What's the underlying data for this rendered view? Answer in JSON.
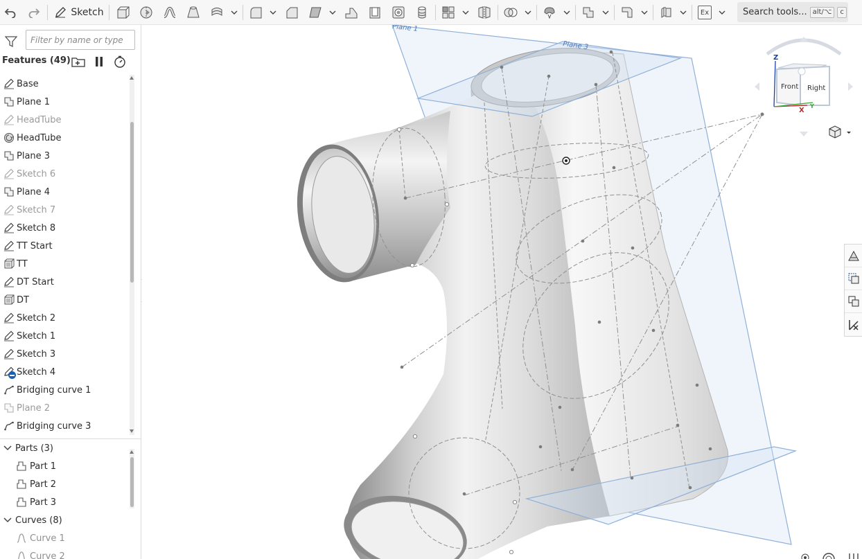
{
  "toolbar": {
    "sketch_label": "Sketch",
    "ex_label": "Ex",
    "search_label": "Search tools...",
    "search_shortcut_mod": "alt/⌥",
    "search_shortcut_key": "c"
  },
  "sidebar": {
    "filter_placeholder": "Filter by name or type",
    "features_header": "Features (49)",
    "features": [
      {
        "label": "Base",
        "icon": "sketch-icon",
        "dim": false
      },
      {
        "label": "Plane 1",
        "icon": "plane-icon",
        "dim": false
      },
      {
        "label": "HeadTube",
        "icon": "sketch-icon",
        "dim": true
      },
      {
        "label": "HeadTube",
        "icon": "revolve-icon",
        "dim": false
      },
      {
        "label": "Plane 3",
        "icon": "plane-icon",
        "dim": false
      },
      {
        "label": "Sketch 6",
        "icon": "sketch-icon",
        "dim": true
      },
      {
        "label": "Plane 4",
        "icon": "plane-icon",
        "dim": false
      },
      {
        "label": "Sketch 7",
        "icon": "sketch-icon",
        "dim": true
      },
      {
        "label": "Sketch 8",
        "icon": "sketch-icon",
        "dim": false
      },
      {
        "label": "TT Start",
        "icon": "sketch-icon",
        "dim": false
      },
      {
        "label": "TT",
        "icon": "extrude-icon",
        "dim": false
      },
      {
        "label": "DT Start",
        "icon": "sketch-icon",
        "dim": false
      },
      {
        "label": "DT",
        "icon": "extrude-icon",
        "dim": false
      },
      {
        "label": "Sketch 2",
        "icon": "sketch-icon",
        "dim": false
      },
      {
        "label": "Sketch 1",
        "icon": "sketch-icon",
        "dim": false
      },
      {
        "label": "Sketch 3",
        "icon": "sketch-icon",
        "dim": false
      },
      {
        "label": "Sketch 4",
        "icon": "sketch-error-icon",
        "dim": false
      },
      {
        "label": "Bridging curve 1",
        "icon": "curve-icon",
        "dim": false
      },
      {
        "label": "Plane 2",
        "icon": "plane-icon",
        "dim": true
      },
      {
        "label": "Bridging curve 3",
        "icon": "curve-icon",
        "dim": false
      }
    ],
    "groups": {
      "parts_label": "Parts (3)",
      "parts": [
        "Part 1",
        "Part 2",
        "Part 3"
      ],
      "curves_label": "Curves (8)",
      "curves": [
        "Curve 1",
        "Curve 2"
      ]
    }
  },
  "viewport": {
    "plane_labels": [
      "Plane 1",
      "Plane 3"
    ],
    "view_cube": {
      "front_label": "Front",
      "right_label": "Right",
      "axis_z": "Z",
      "axis_x": "X",
      "axis_y": "Y"
    }
  },
  "colors": {
    "accent": "#1a5fb4",
    "plane_fill": "#c9dcf0",
    "plane_stroke": "#8fb0d8",
    "model_base": "#d9d9d9"
  }
}
